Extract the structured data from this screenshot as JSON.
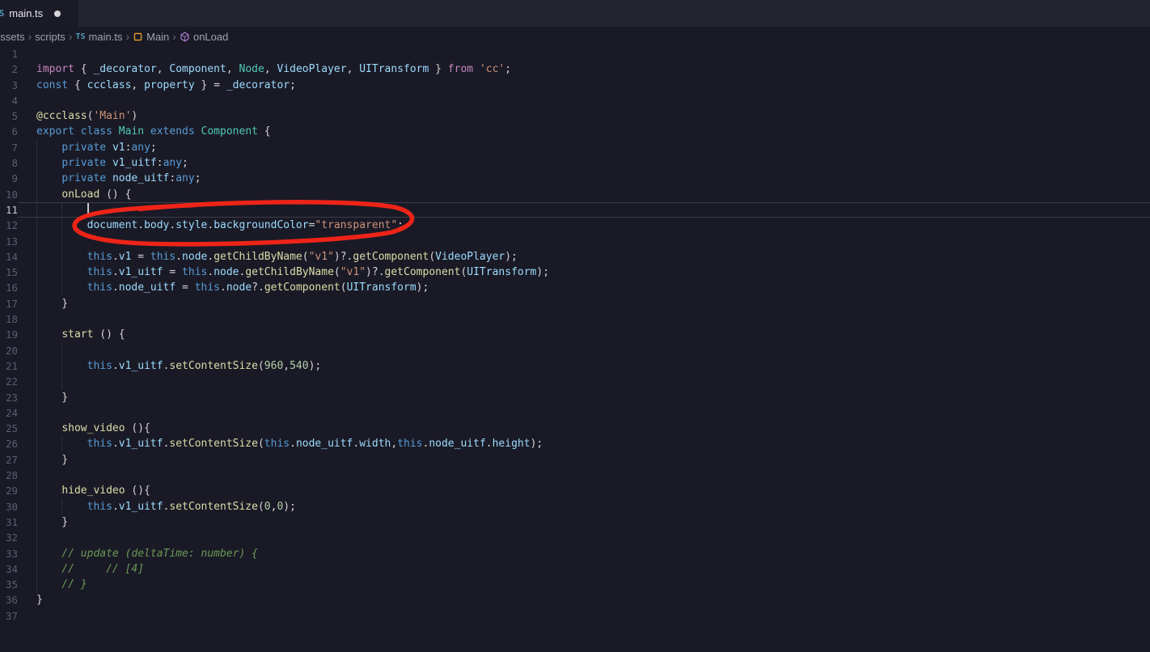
{
  "tab_bar": {
    "active_tab": {
      "label": "main.ts",
      "file_icon": "TS",
      "modified": true
    }
  },
  "breadcrumb": {
    "separator": "›",
    "items": [
      {
        "label": "assets"
      },
      {
        "label": "scripts"
      },
      {
        "label": "main.ts",
        "icon": "typescript-icon"
      },
      {
        "label": "Main",
        "icon": "class-icon"
      },
      {
        "label": "onLoad",
        "icon": "method-icon"
      }
    ]
  },
  "editor": {
    "active_line": 11,
    "cursor": {
      "line": 11,
      "column": 8
    },
    "lines": [
      {
        "n": 1,
        "tokens": []
      },
      {
        "n": 2,
        "tokens": [
          [
            "import",
            "kw"
          ],
          [
            " { ",
            "pl"
          ],
          [
            "_decorator",
            "vr"
          ],
          [
            ", ",
            "pl"
          ],
          [
            "Component",
            "vr"
          ],
          [
            ", ",
            "pl"
          ],
          [
            "Node",
            "ty"
          ],
          [
            ", ",
            "pl"
          ],
          [
            "VideoPlayer",
            "vr"
          ],
          [
            ", ",
            "pl"
          ],
          [
            "UITransform",
            "vr"
          ],
          [
            " } ",
            "pl"
          ],
          [
            "from",
            "kw"
          ],
          [
            " ",
            "pl"
          ],
          [
            "'cc'",
            "st"
          ],
          [
            ";",
            "pl"
          ]
        ]
      },
      {
        "n": 3,
        "tokens": [
          [
            "const",
            "kb"
          ],
          [
            " { ",
            "pl"
          ],
          [
            "ccclass",
            "vr"
          ],
          [
            ", ",
            "pl"
          ],
          [
            "property",
            "vr"
          ],
          [
            " } ",
            "pl"
          ],
          [
            "= ",
            "pl"
          ],
          [
            "_decorator",
            "vr"
          ],
          [
            ";",
            "pl"
          ]
        ]
      },
      {
        "n": 4,
        "tokens": []
      },
      {
        "n": 5,
        "tokens": [
          [
            "@ccclass",
            "fn"
          ],
          [
            "(",
            "pl"
          ],
          [
            "'Main'",
            "st"
          ],
          [
            ")",
            "pl"
          ]
        ]
      },
      {
        "n": 6,
        "tokens": [
          [
            "export",
            "kb"
          ],
          [
            " ",
            "pl"
          ],
          [
            "class",
            "kb"
          ],
          [
            " ",
            "pl"
          ],
          [
            "Main",
            "ty"
          ],
          [
            " ",
            "pl"
          ],
          [
            "extends",
            "kb"
          ],
          [
            " ",
            "pl"
          ],
          [
            "Component",
            "ty"
          ],
          [
            " {",
            "pl"
          ]
        ]
      },
      {
        "n": 7,
        "guides": [
          0
        ],
        "tokens": [
          [
            "    ",
            "pl"
          ],
          [
            "private",
            "kb"
          ],
          [
            " ",
            "pl"
          ],
          [
            "v1",
            "vr"
          ],
          [
            ":",
            "pl"
          ],
          [
            "any",
            "kb"
          ],
          [
            ";",
            "pl"
          ]
        ]
      },
      {
        "n": 8,
        "guides": [
          0
        ],
        "tokens": [
          [
            "    ",
            "pl"
          ],
          [
            "private",
            "kb"
          ],
          [
            " ",
            "pl"
          ],
          [
            "v1_uitf",
            "vr"
          ],
          [
            ":",
            "pl"
          ],
          [
            "any",
            "kb"
          ],
          [
            ";",
            "pl"
          ]
        ]
      },
      {
        "n": 9,
        "guides": [
          0
        ],
        "tokens": [
          [
            "    ",
            "pl"
          ],
          [
            "private",
            "kb"
          ],
          [
            " ",
            "pl"
          ],
          [
            "node_uitf",
            "vr"
          ],
          [
            ":",
            "pl"
          ],
          [
            "any",
            "kb"
          ],
          [
            ";",
            "pl"
          ]
        ]
      },
      {
        "n": 10,
        "guides": [
          0
        ],
        "tokens": [
          [
            "    ",
            "pl"
          ],
          [
            "onLoad",
            "fn"
          ],
          [
            " () {",
            "pl"
          ]
        ]
      },
      {
        "n": 11,
        "guides": [
          0,
          4
        ],
        "cursor_col": 8,
        "tokens": []
      },
      {
        "n": 12,
        "guides": [
          0,
          4
        ],
        "tokens": [
          [
            "        ",
            "pl"
          ],
          [
            "document",
            "vr"
          ],
          [
            ".",
            "pl"
          ],
          [
            "body",
            "vr"
          ],
          [
            ".",
            "pl"
          ],
          [
            "style",
            "vr"
          ],
          [
            ".",
            "pl"
          ],
          [
            "backgroundColor",
            "vr"
          ],
          [
            "=",
            "pl"
          ],
          [
            "\"transparent\"",
            "st"
          ],
          [
            ";",
            "pl"
          ]
        ]
      },
      {
        "n": 13,
        "guides": [
          0,
          4
        ],
        "tokens": []
      },
      {
        "n": 14,
        "guides": [
          0,
          4
        ],
        "tokens": [
          [
            "        ",
            "pl"
          ],
          [
            "this",
            "kb"
          ],
          [
            ".",
            "pl"
          ],
          [
            "v1",
            "vr"
          ],
          [
            " = ",
            "pl"
          ],
          [
            "this",
            "kb"
          ],
          [
            ".",
            "pl"
          ],
          [
            "node",
            "vr"
          ],
          [
            ".",
            "pl"
          ],
          [
            "getChildByName",
            "fn"
          ],
          [
            "(",
            "pl"
          ],
          [
            "\"v1\"",
            "st"
          ],
          [
            ")?.",
            "pl"
          ],
          [
            "getComponent",
            "fn"
          ],
          [
            "(",
            "pl"
          ],
          [
            "VideoPlayer",
            "vr"
          ],
          [
            ");",
            "pl"
          ]
        ]
      },
      {
        "n": 15,
        "guides": [
          0,
          4
        ],
        "tokens": [
          [
            "        ",
            "pl"
          ],
          [
            "this",
            "kb"
          ],
          [
            ".",
            "pl"
          ],
          [
            "v1_uitf",
            "vr"
          ],
          [
            " = ",
            "pl"
          ],
          [
            "this",
            "kb"
          ],
          [
            ".",
            "pl"
          ],
          [
            "node",
            "vr"
          ],
          [
            ".",
            "pl"
          ],
          [
            "getChildByName",
            "fn"
          ],
          [
            "(",
            "pl"
          ],
          [
            "\"v1\"",
            "st"
          ],
          [
            ")?.",
            "pl"
          ],
          [
            "getComponent",
            "fn"
          ],
          [
            "(",
            "pl"
          ],
          [
            "UITransform",
            "vr"
          ],
          [
            ");",
            "pl"
          ]
        ]
      },
      {
        "n": 16,
        "guides": [
          0,
          4
        ],
        "tokens": [
          [
            "        ",
            "pl"
          ],
          [
            "this",
            "kb"
          ],
          [
            ".",
            "pl"
          ],
          [
            "node_uitf",
            "vr"
          ],
          [
            " = ",
            "pl"
          ],
          [
            "this",
            "kb"
          ],
          [
            ".",
            "pl"
          ],
          [
            "node",
            "vr"
          ],
          [
            "?.",
            "pl"
          ],
          [
            "getComponent",
            "fn"
          ],
          [
            "(",
            "pl"
          ],
          [
            "UITransform",
            "vr"
          ],
          [
            ");",
            "pl"
          ]
        ]
      },
      {
        "n": 17,
        "guides": [
          0
        ],
        "tokens": [
          [
            "    }",
            "pl"
          ]
        ]
      },
      {
        "n": 18,
        "guides": [
          0
        ],
        "tokens": []
      },
      {
        "n": 19,
        "guides": [
          0
        ],
        "tokens": [
          [
            "    ",
            "pl"
          ],
          [
            "start",
            "fn"
          ],
          [
            " () {",
            "pl"
          ]
        ]
      },
      {
        "n": 20,
        "guides": [
          0,
          4
        ],
        "tokens": []
      },
      {
        "n": 21,
        "guides": [
          0,
          4
        ],
        "tokens": [
          [
            "        ",
            "pl"
          ],
          [
            "this",
            "kb"
          ],
          [
            ".",
            "pl"
          ],
          [
            "v1_uitf",
            "vr"
          ],
          [
            ".",
            "pl"
          ],
          [
            "setContentSize",
            "fn"
          ],
          [
            "(",
            "pl"
          ],
          [
            "960",
            "nu"
          ],
          [
            ",",
            "pl"
          ],
          [
            "540",
            "nu"
          ],
          [
            ");",
            "pl"
          ]
        ]
      },
      {
        "n": 22,
        "guides": [
          0,
          4
        ],
        "tokens": []
      },
      {
        "n": 23,
        "guides": [
          0
        ],
        "tokens": [
          [
            "    }",
            "pl"
          ]
        ]
      },
      {
        "n": 24,
        "guides": [
          0
        ],
        "tokens": []
      },
      {
        "n": 25,
        "guides": [
          0
        ],
        "tokens": [
          [
            "    ",
            "pl"
          ],
          [
            "show_video",
            "fn"
          ],
          [
            " (){",
            "pl"
          ]
        ]
      },
      {
        "n": 26,
        "guides": [
          0,
          4
        ],
        "tokens": [
          [
            "        ",
            "pl"
          ],
          [
            "this",
            "kb"
          ],
          [
            ".",
            "pl"
          ],
          [
            "v1_uitf",
            "vr"
          ],
          [
            ".",
            "pl"
          ],
          [
            "setContentSize",
            "fn"
          ],
          [
            "(",
            "pl"
          ],
          [
            "this",
            "kb"
          ],
          [
            ".",
            "pl"
          ],
          [
            "node_uitf",
            "vr"
          ],
          [
            ".",
            "pl"
          ],
          [
            "width",
            "vr"
          ],
          [
            ",",
            "pl"
          ],
          [
            "this",
            "kb"
          ],
          [
            ".",
            "pl"
          ],
          [
            "node_uitf",
            "vr"
          ],
          [
            ".",
            "pl"
          ],
          [
            "height",
            "vr"
          ],
          [
            ");",
            "pl"
          ]
        ]
      },
      {
        "n": 27,
        "guides": [
          0
        ],
        "tokens": [
          [
            "    }",
            "pl"
          ]
        ]
      },
      {
        "n": 28,
        "guides": [
          0
        ],
        "tokens": []
      },
      {
        "n": 29,
        "guides": [
          0
        ],
        "tokens": [
          [
            "    ",
            "pl"
          ],
          [
            "hide_video",
            "fn"
          ],
          [
            " (){",
            "pl"
          ]
        ]
      },
      {
        "n": 30,
        "guides": [
          0,
          4
        ],
        "tokens": [
          [
            "        ",
            "pl"
          ],
          [
            "this",
            "kb"
          ],
          [
            ".",
            "pl"
          ],
          [
            "v1_uitf",
            "vr"
          ],
          [
            ".",
            "pl"
          ],
          [
            "setContentSize",
            "fn"
          ],
          [
            "(",
            "pl"
          ],
          [
            "0",
            "nu"
          ],
          [
            ",",
            "pl"
          ],
          [
            "0",
            "nu"
          ],
          [
            ");",
            "pl"
          ]
        ]
      },
      {
        "n": 31,
        "guides": [
          0
        ],
        "tokens": [
          [
            "    }",
            "pl"
          ]
        ]
      },
      {
        "n": 32,
        "guides": [
          0
        ],
        "tokens": []
      },
      {
        "n": 33,
        "guides": [
          0
        ],
        "tokens": [
          [
            "    // update (deltaTime: number) {",
            "cm"
          ]
        ]
      },
      {
        "n": 34,
        "guides": [
          0
        ],
        "tokens": [
          [
            "    //     // [4]",
            "cm"
          ]
        ]
      },
      {
        "n": 35,
        "guides": [
          0
        ],
        "tokens": [
          [
            "    // }",
            "cm"
          ]
        ]
      },
      {
        "n": 36,
        "tokens": [
          [
            "}",
            "pl"
          ]
        ]
      },
      {
        "n": 37,
        "tokens": []
      }
    ]
  },
  "annotation": {
    "type": "hand-drawn-ellipse",
    "color": "#ee2418",
    "line": 12,
    "highlights": "document.body.style.backgroundColor=\"transparent\";"
  },
  "colors": {
    "editor_background": "#1a1a26",
    "tab_bar_background": "#24242f",
    "keyword_pink": "#c586c0",
    "keyword_blue": "#569cd6",
    "class_teal": "#4ec9b0",
    "function_yellow": "#dcdcaa",
    "variable_blue": "#9cdcfe",
    "string_orange": "#ce9178",
    "number_green": "#b5cea8",
    "comment_green": "#6a9955",
    "annotation_red": "#ee2418"
  }
}
